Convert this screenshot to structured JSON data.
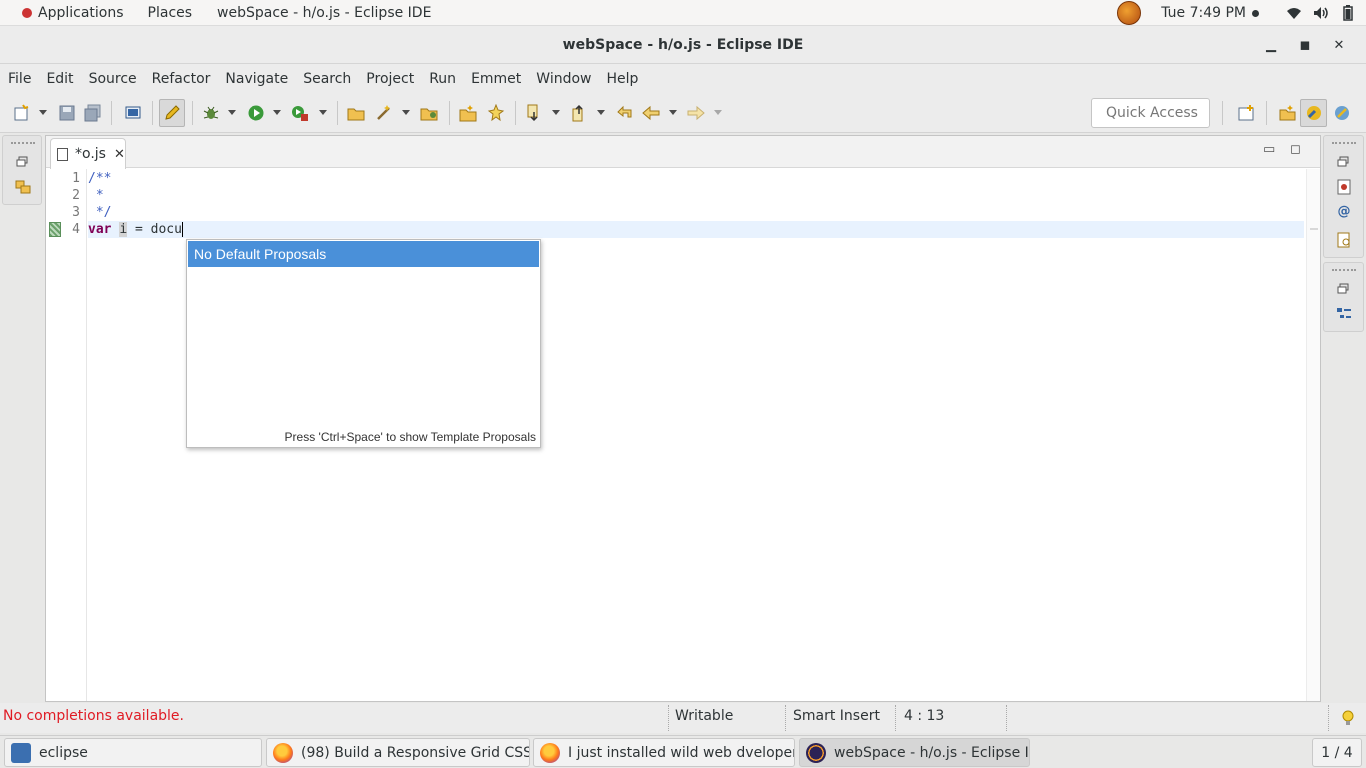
{
  "topbar": {
    "applications": "Applications",
    "places": "Places",
    "active_app": "webSpace - h/o.js - Eclipse IDE",
    "clock": "Tue  7:49 PM"
  },
  "window": {
    "title": "webSpace - h/o.js - Eclipse IDE"
  },
  "menu": {
    "items": [
      "File",
      "Edit",
      "Source",
      "Refactor",
      "Navigate",
      "Search",
      "Project",
      "Run",
      "Emmet",
      "Window",
      "Help"
    ]
  },
  "toolbar": {
    "quick_access_placeholder": "Quick Access"
  },
  "editor": {
    "tab_label": "*o.js",
    "line_numbers": [
      "1",
      "2",
      "3",
      "4"
    ],
    "lines": {
      "l1": "/**",
      "l2": " *",
      "l3": " */",
      "l4_kw": "var",
      "l4_var": "i",
      "l4_rest": " = docu"
    }
  },
  "content_assist": {
    "selected": "No Default Proposals",
    "hint": "Press 'Ctrl+Space' to show Template Proposals"
  },
  "statusbar": {
    "message": "No completions available.",
    "writable": "Writable",
    "insert_mode": "Smart Insert",
    "position": "4 : 13"
  },
  "taskbar": {
    "tasks": [
      "eclipse",
      "(98) Build a Responsive Grid CSS W...",
      "I just installed wild web dveloper in ...",
      "webSpace - h/o.js - Eclipse IDE"
    ],
    "workspace": "1 / 4"
  },
  "colors": {
    "selection_blue": "#4a90d9",
    "comment_blue": "#3f5fbf",
    "keyword_purple": "#7f0055",
    "error_red": "#e01b24"
  }
}
